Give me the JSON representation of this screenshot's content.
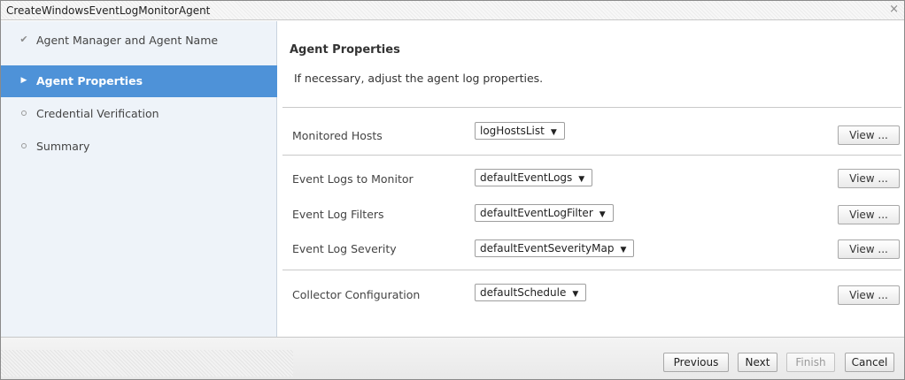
{
  "window": {
    "title": "CreateWindowsEventLogMonitorAgent",
    "close_glyph": "×"
  },
  "colors": {
    "active_nav": "#4e92d8",
    "sidebar_bg": "#eef3f9"
  },
  "sidebar": {
    "items": [
      {
        "label": "Agent Manager and Agent Name",
        "state": "completed",
        "icon": "check-icon",
        "glyph": "✔"
      },
      {
        "label": "Agent Properties",
        "state": "active",
        "icon": "triangle-right-icon",
        "glyph": "▶"
      },
      {
        "label": "Credential Verification",
        "state": "pending",
        "icon": "circle-icon",
        "glyph": ""
      },
      {
        "label": "Summary",
        "state": "pending",
        "icon": "circle-icon",
        "glyph": ""
      }
    ]
  },
  "main": {
    "heading": "Agent Properties",
    "description": "If necessary, adjust the agent log properties.",
    "properties": [
      {
        "label": "Monitored Hosts",
        "value": "logHostsList",
        "button": "View ..."
      },
      {
        "label": "Event Logs to Monitor",
        "value": "defaultEventLogs",
        "button": "View ..."
      },
      {
        "label": "Event Log Filters",
        "value": "defaultEventLogFilter",
        "button": "View ..."
      },
      {
        "label": "Event Log Severity",
        "value": "defaultEventSeverityMap",
        "button": "View ..."
      },
      {
        "label": "Collector Configuration",
        "value": "defaultSchedule",
        "button": "View ..."
      }
    ],
    "dropdown_glyph": "▼"
  },
  "footer": {
    "previous": "Previous",
    "next": "Next",
    "finish": "Finish",
    "cancel": "Cancel"
  }
}
